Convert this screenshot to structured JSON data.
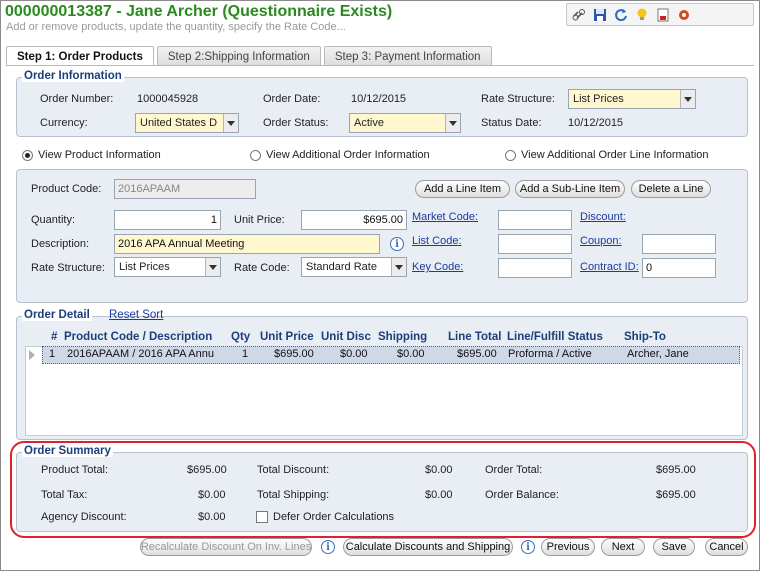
{
  "header": {
    "title": "000000013387 - Jane Archer (Questionnaire Exists)",
    "subtitle": "Add or remove products, update the quantity, specify the Rate Code..."
  },
  "toolbar": {
    "icons": [
      "link-icon",
      "save-icon",
      "refresh-icon",
      "lightbulb-icon",
      "report-icon",
      "tools-icon"
    ]
  },
  "tabs": [
    {
      "label": "Step 1: Order Products",
      "active": true
    },
    {
      "label": "Step 2:Shipping Information",
      "active": false
    },
    {
      "label": "Step 3: Payment Information",
      "active": false
    }
  ],
  "order_info": {
    "legend": "Order Information",
    "order_number_label": "Order Number:",
    "order_number": "1000045928",
    "order_date_label": "Order Date:",
    "order_date": "10/12/2015",
    "rate_structure_label": "Rate Structure:",
    "rate_structure": "List Prices",
    "currency_label": "Currency:",
    "currency": "United States D",
    "order_status_label": "Order Status:",
    "order_status": "Active",
    "status_date_label": "Status Date:",
    "status_date": "10/12/2015"
  },
  "views": {
    "product": "View Product Information",
    "additional_order": "View Additional Order Information",
    "additional_line": "View Additional Order Line Information"
  },
  "product_info": {
    "product_code_label": "Product Code:",
    "product_code": "2016APAAM",
    "add_line_item": "Add a Line Item",
    "add_sub_line_item": "Add a Sub-Line Item",
    "delete_line": "Delete a Line",
    "quantity_label": "Quantity:",
    "quantity": "1",
    "unit_price_label": "Unit Price:",
    "unit_price": "$695.00",
    "market_code_link": "Market Code:",
    "discount_link": "Discount:",
    "description_label": "Description:",
    "description": "2016 APA Annual Meeting",
    "list_code_link": "List Code:",
    "coupon_link": "Coupon:",
    "rate_structure_label": "Rate Structure:",
    "rate_structure": "List Prices",
    "rate_code_label": "Rate Code:",
    "rate_code": "Standard Rate",
    "key_code_link": "Key Code:",
    "contract_id_link": "Contract ID:",
    "contract_id": "0"
  },
  "order_detail": {
    "legend": "Order Detail",
    "reset_sort": "Reset Sort",
    "columns": [
      "#",
      "Product Code / Description",
      "Qty",
      "Unit Price",
      "Unit Disc",
      "Shipping",
      "Line Total",
      "Line/Fulfill Status",
      "Ship-To"
    ],
    "rows": [
      [
        "1",
        "2016APAAM / 2016 APA Annu",
        "1",
        "$695.00",
        "$0.00",
        "$0.00",
        "$695.00",
        "Proforma / Active",
        "Archer, Jane"
      ]
    ]
  },
  "order_summary": {
    "legend": "Order Summary",
    "product_total_label": "Product Total:",
    "product_total": "$695.00",
    "total_discount_label": "Total Discount:",
    "total_discount": "$0.00",
    "order_total_label": "Order Total:",
    "order_total": "$695.00",
    "total_tax_label": "Total Tax:",
    "total_tax": "$0.00",
    "total_shipping_label": "Total Shipping:",
    "total_shipping": "$0.00",
    "order_balance_label": "Order Balance:",
    "order_balance": "$695.00",
    "agency_discount_label": "Agency Discount:",
    "agency_discount": "$0.00",
    "defer_label": "Defer Order Calculations"
  },
  "footer": {
    "recalculate": "Recalculate Discount On Inv. Lines",
    "calculate": "Calculate Discounts and Shipping",
    "previous": "Previous",
    "next": "Next",
    "save": "Save",
    "cancel": "Cancel"
  },
  "colors": {
    "title": "#2a8a1e",
    "highlight": "#e0202a",
    "legend": "#1c3f7a"
  }
}
